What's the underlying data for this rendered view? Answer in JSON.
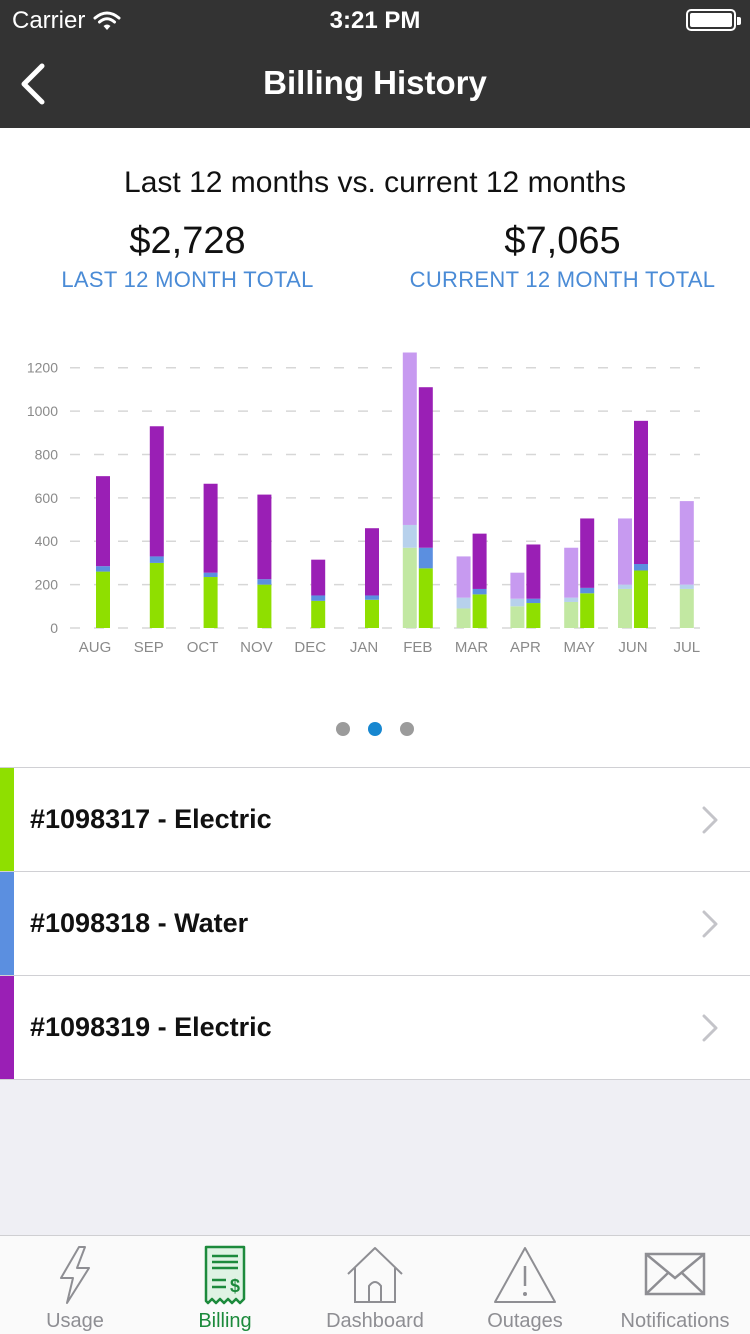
{
  "status": {
    "carrier": "Carrier",
    "time": "3:21 PM"
  },
  "nav": {
    "title": "Billing History"
  },
  "summary": {
    "title": "Last 12 months vs. current 12 months",
    "last_total": "$2,728",
    "last_label": "LAST 12 MONTH TOTAL",
    "current_total": "$7,065",
    "current_label": "CURRENT 12 MONTH TOTAL"
  },
  "colors": {
    "electric1": "#8fdf00",
    "water": "#5b8fe0",
    "electric2": "#9a1fb5",
    "electric1_light": "#c2e8a2",
    "water_light": "#b7d1ec",
    "electric2_light": "#c79af0",
    "accent_blue": "#4a8bd6",
    "tab_active": "#1c8a3c"
  },
  "chart_data": {
    "type": "bar",
    "stacked": true,
    "categories": [
      "AUG",
      "SEP",
      "OCT",
      "NOV",
      "DEC",
      "JAN",
      "FEB",
      "MAR",
      "APR",
      "MAY",
      "JUN",
      "JUL"
    ],
    "yticks": [
      0,
      200,
      400,
      600,
      800,
      1000,
      1200
    ],
    "ylim": [
      0,
      1300
    ],
    "grid": true,
    "groups": [
      {
        "period": "last 12 months",
        "style": "light",
        "series": [
          {
            "account": "#1098317 - Electric",
            "values": [
              null,
              null,
              null,
              null,
              null,
              null,
              370,
              90,
              100,
              120,
              180,
              180
            ]
          },
          {
            "account": "#1098318 - Water",
            "values": [
              null,
              null,
              null,
              null,
              null,
              null,
              105,
              50,
              35,
              20,
              20,
              20
            ]
          },
          {
            "account": "#1098319 - Electric",
            "values": [
              null,
              null,
              null,
              null,
              null,
              null,
              795,
              190,
              120,
              230,
              305,
              385
            ]
          }
        ]
      },
      {
        "period": "current 12 months",
        "style": "solid",
        "series": [
          {
            "account": "#1098317 - Electric",
            "values": [
              260,
              300,
              235,
              200,
              125,
              130,
              275,
              155,
              115,
              160,
              265,
              null
            ]
          },
          {
            "account": "#1098318 - Water",
            "values": [
              25,
              30,
              20,
              25,
              25,
              20,
              95,
              25,
              20,
              25,
              30,
              null
            ]
          },
          {
            "account": "#1098319 - Electric",
            "values": [
              415,
              600,
              410,
              390,
              165,
              310,
              740,
              255,
              250,
              320,
              660,
              null
            ]
          }
        ]
      }
    ]
  },
  "pager": {
    "count": 3,
    "active": 1
  },
  "accounts": [
    {
      "label": "#1098317 - Electric",
      "color": "#8fdf00"
    },
    {
      "label": "#1098318 - Water",
      "color": "#5b8fe0"
    },
    {
      "label": "#1098319 - Electric",
      "color": "#9a1fb5"
    }
  ],
  "tabs": [
    {
      "label": "Usage",
      "icon": "lightning-icon"
    },
    {
      "label": "Billing",
      "icon": "bill-icon",
      "active": true
    },
    {
      "label": "Dashboard",
      "icon": "house-icon"
    },
    {
      "label": "Outages",
      "icon": "warning-icon"
    },
    {
      "label": "Notifications",
      "icon": "envelope-icon"
    }
  ]
}
